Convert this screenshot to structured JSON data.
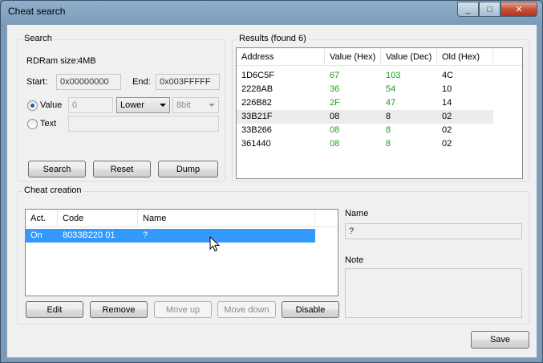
{
  "window": {
    "title": "Cheat search",
    "minimize": "_",
    "maximize": "□",
    "close": "✕"
  },
  "search": {
    "group_label": "Search",
    "rdram_label": "RDRam size:",
    "rdram_value": "4MB",
    "start_label": "Start:",
    "start_value": "0x00000000",
    "end_label": "End:",
    "end_value": "0x003FFFFF",
    "value_radio_label": "Value",
    "value_input": "0",
    "compare_select": "Lower",
    "size_select": "8bit",
    "text_radio_label": "Text",
    "text_input": "",
    "search_button": "Search",
    "reset_button": "Reset",
    "dump_button": "Dump"
  },
  "results": {
    "group_label": "Results (found 6)",
    "columns": [
      "Address",
      "Value (Hex)",
      "Value (Dec)",
      "Old (Hex)"
    ],
    "rows": [
      {
        "address": "1D6C5F",
        "hex": "67",
        "dec": "103",
        "old": "4C",
        "changed": true
      },
      {
        "address": "2228AB",
        "hex": "36",
        "dec": "54",
        "old": "10",
        "changed": true
      },
      {
        "address": "226B82",
        "hex": "2F",
        "dec": "47",
        "old": "14",
        "changed": true
      },
      {
        "address": "33B21F",
        "hex": "08",
        "dec": "8",
        "old": "02",
        "changed": false
      },
      {
        "address": "33B266",
        "hex": "08",
        "dec": "8",
        "old": "02",
        "changed": true
      },
      {
        "address": "361440",
        "hex": "08",
        "dec": "8",
        "old": "02",
        "changed": true
      }
    ]
  },
  "creation": {
    "group_label": "Cheat creation",
    "columns": [
      "Act.",
      "Code",
      "Name"
    ],
    "rows": [
      {
        "act": "On",
        "code": "8033B220 01",
        "name": "?"
      }
    ],
    "edit_button": "Edit",
    "remove_button": "Remove",
    "move_up_button": "Move up",
    "move_down_button": "Move down",
    "disable_button": "Disable",
    "name_label": "Name",
    "name_value": "?",
    "note_label": "Note",
    "note_value": ""
  },
  "footer": {
    "save_button": "Save"
  },
  "colors": {
    "changed_value": "#1aa01a",
    "selection": "#3399ff"
  }
}
